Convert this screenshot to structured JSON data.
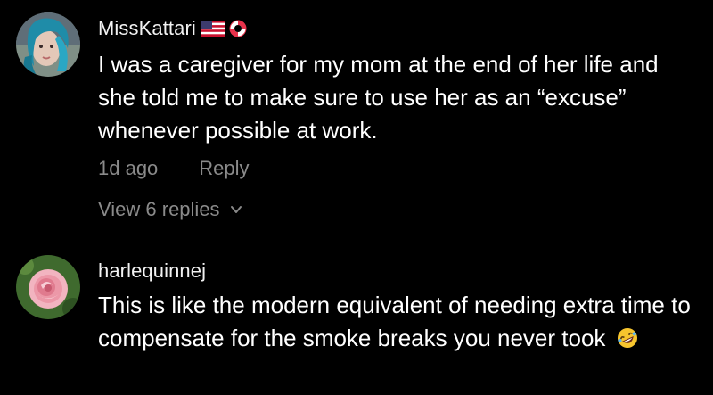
{
  "comments": [
    {
      "username": "MissKattari",
      "badges": [
        "us-flag-icon",
        "lifebuoy-icon"
      ],
      "text": "I was a caregiver for my mom at the end of her life and she told me to make sure to use her as an “excuse” whenever possible at work.",
      "timestamp": "1d ago",
      "reply_label": "Reply",
      "view_replies_label": "View 6 replies"
    },
    {
      "username": "harlequinnej",
      "text": "This is like the modern equivalent of needing extra time to compensate for the smoke breaks you never took",
      "emoji": "rolling-on-floor-laughing-icon"
    }
  ],
  "colors": {
    "background": "#000000",
    "text": "#ffffff",
    "muted": "#8a8a8a",
    "accent": "#fe2c55"
  }
}
